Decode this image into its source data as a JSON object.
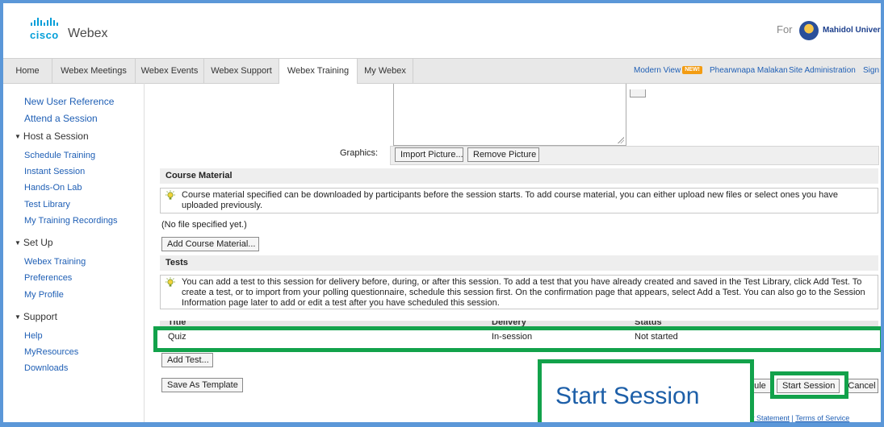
{
  "header": {
    "brand_top": "cisco",
    "brand_product": "Webex",
    "for_label": "For",
    "org_name": "Mahidol University"
  },
  "nav": {
    "tabs": [
      "Home",
      "Webex Meetings",
      "Webex Events",
      "Webex Support",
      "Webex Training",
      "My Webex"
    ],
    "active_tab": "Webex Training",
    "modern_view": "Modern View",
    "new_badge": "NEW!",
    "user_name": "Phearwnapa Malakan",
    "site_admin": "Site Administration",
    "sign_out": "Sign O"
  },
  "sidebar": {
    "new_user_reference": "New User Reference",
    "attend_session": "Attend a Session",
    "host_session_heading": "Host a Session",
    "host_items": [
      "Schedule Training",
      "Instant Session",
      "Hands-On Lab",
      "Test Library",
      "My Training Recordings"
    ],
    "setup_heading": "Set Up",
    "setup_items": [
      "Webex Training",
      "Preferences",
      "My Profile"
    ],
    "support_heading": "Support",
    "support_items": [
      "Help",
      "MyResources",
      "Downloads"
    ]
  },
  "graphics": {
    "label": "Graphics:",
    "import_button": "Import Picture...",
    "remove_button": "Remove Picture"
  },
  "course_material": {
    "heading": "Course Material",
    "note": "Course material specified can be downloaded by participants before the session starts. To add course material, you can either upload new files or select ones you have uploaded previously.",
    "no_file": "(No file specified yet.)",
    "add_button": "Add Course Material..."
  },
  "tests": {
    "heading": "Tests",
    "note": "You can add a test to this session for delivery before, during, or after this session. To add a test that you have already created and saved in the Test Library, click Add Test. To create a test, or to import from your polling questionnaire, schedule this session first. On the confirmation page that appears, select Add a Test. You can also go to the Session Information page later to add or edit a test after you have scheduled this session.",
    "columns": [
      "Title",
      "Delivery",
      "Status"
    ],
    "rows": [
      {
        "title": "Quiz",
        "delivery": "In-session",
        "status": "Not started"
      }
    ],
    "add_button": "Add Test..."
  },
  "actions": {
    "save_template": "Save As Template",
    "schedule_partial": "dule",
    "start_session": "Start Session",
    "cancel_partial": "Cancel"
  },
  "callout": {
    "text": "Start Session"
  },
  "footer": {
    "privacy_partial": "y Statement",
    "separator": "|",
    "terms": "Terms of Service"
  },
  "colors": {
    "highlight": "#12a24b",
    "link": "#1f5fb5",
    "frame": "#5b97d8",
    "callout_text": "#1d5fa8"
  }
}
